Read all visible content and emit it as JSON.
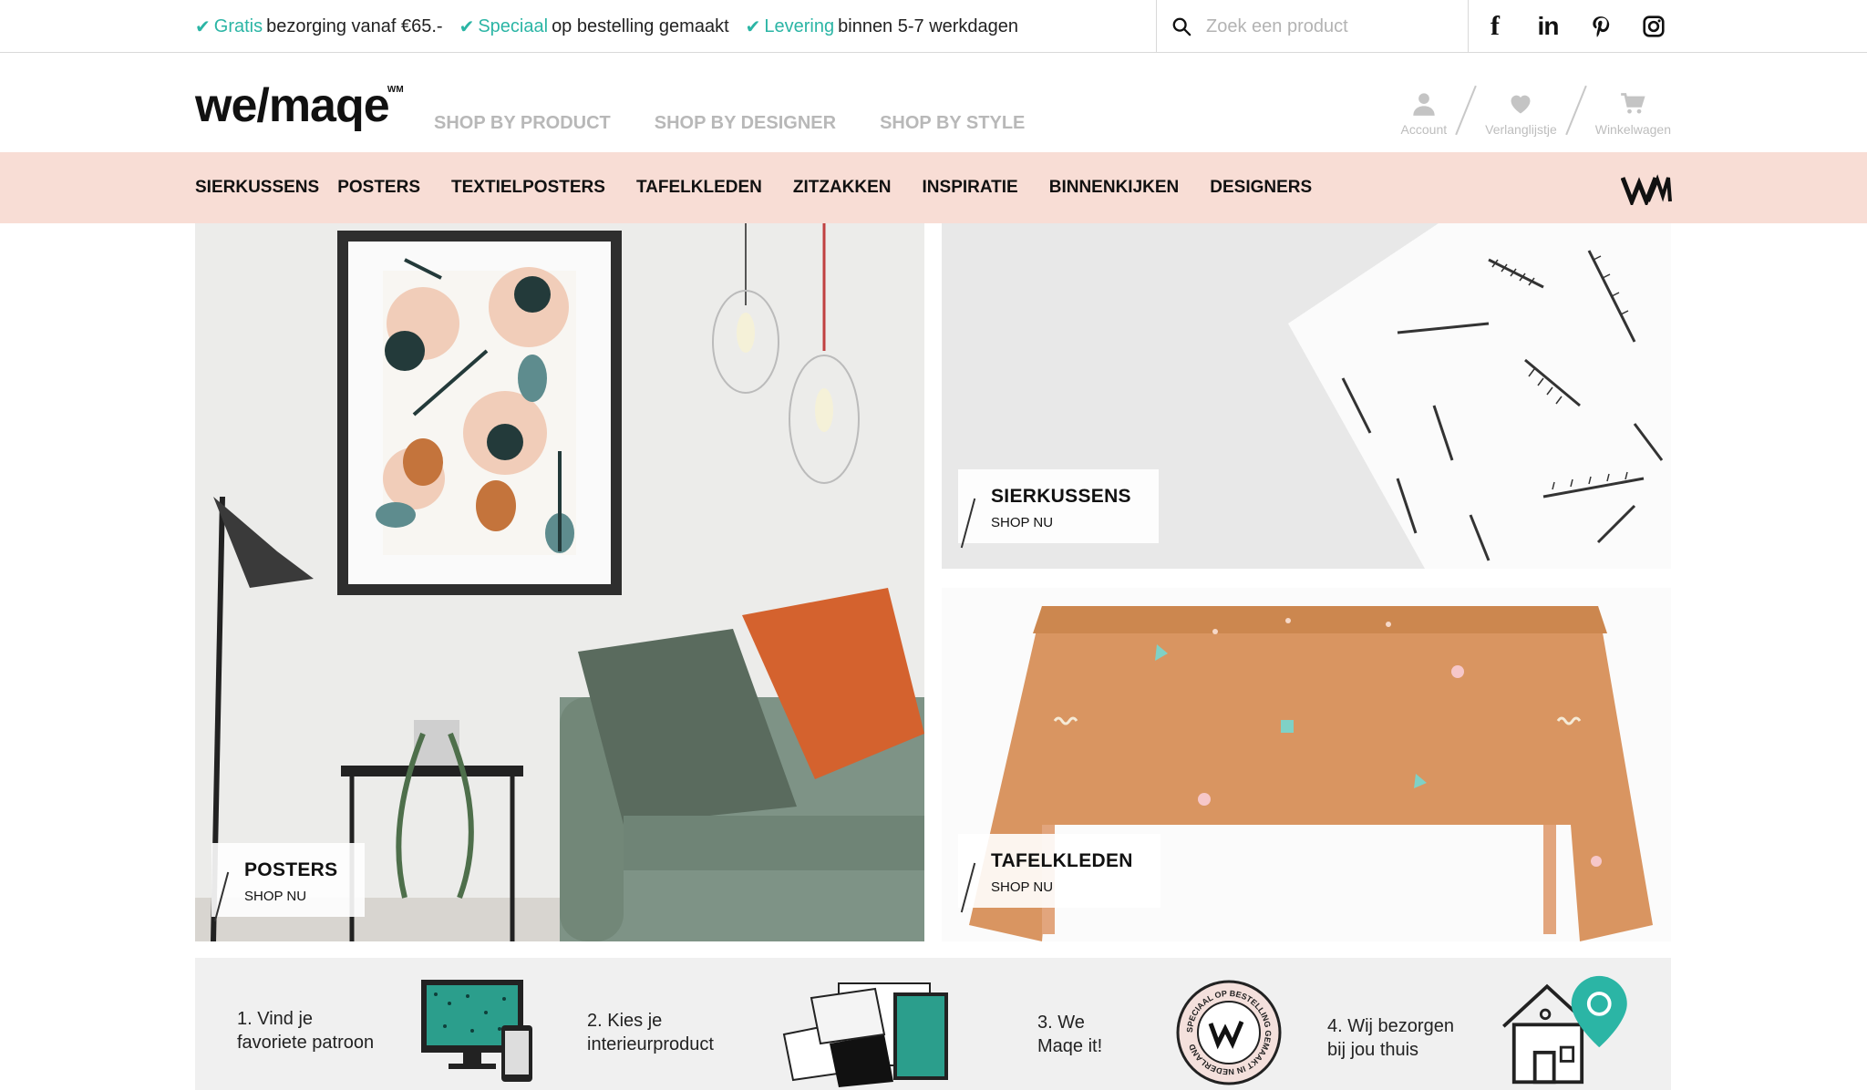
{
  "topbar": {
    "usps": [
      {
        "accent": "Gratis",
        "rest": " bezorging vanaf €65.-"
      },
      {
        "accent": "Speciaal",
        "rest": " op bestelling gemaakt"
      },
      {
        "accent": "Levering",
        "rest": " binnen 5-7 werkdagen"
      }
    ],
    "search": {
      "placeholder": "Zoek een product"
    },
    "socials": [
      "facebook-icon",
      "linkedin-icon",
      "pinterest-icon",
      "instagram-icon"
    ]
  },
  "header": {
    "logo": "we/maqe",
    "logo_mark": "WM",
    "shop_nav": [
      "SHOP BY PRODUCT",
      "SHOP BY DESIGNER",
      "SHOP BY STYLE"
    ],
    "user_nav": {
      "account": "Account",
      "wishlist": "Verlanglijstje",
      "cart": "Winkelwagen"
    }
  },
  "category_nav": [
    "SIERKUSSENS",
    "POSTERS",
    "TEXTIELPOSTERS",
    "TAFELKLEDEN",
    "ZITZAKKEN",
    "INSPIRATIE",
    "BINNENKIJKEN",
    "DESIGNERS"
  ],
  "tiles": {
    "posters": {
      "title": "POSTERS",
      "cta": "SHOP NU"
    },
    "sierkussens": {
      "title": "SIERKUSSENS",
      "cta": "SHOP NU"
    },
    "tafelkleden": {
      "title": "TAFELKLEDEN",
      "cta": "SHOP NU"
    }
  },
  "steps": [
    {
      "text": "1. Vind je\nfavoriete patroon"
    },
    {
      "text": "2. Kies je\ninterieurproduct"
    },
    {
      "text": "3. We\nMaqe it!"
    },
    {
      "text": "4. Wij bezorgen\nbij jou thuis"
    }
  ],
  "badge_text": "SPECIAAL OP BESTELLING GEMAAKT IN NEDERLAND",
  "colors": {
    "accent": "#2bb5a5",
    "nav_bg": "#f8ddd5",
    "steps_bg": "#f0f0f0",
    "tablecloth": "#d99561",
    "cushion_orange": "#d4622e",
    "sofa_green": "#7e9386"
  }
}
